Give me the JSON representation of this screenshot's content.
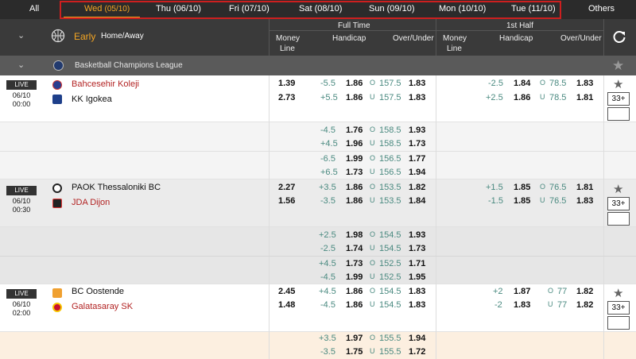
{
  "date_tabs": [
    {
      "label": "All"
    },
    {
      "label": "Wed",
      "date": "(05/10)"
    },
    {
      "label": "Thu (06/10)"
    },
    {
      "label": "Fri (07/10)"
    },
    {
      "label": "Sat (08/10)"
    },
    {
      "label": "Sun (09/10)"
    },
    {
      "label": "Mon (10/10)"
    },
    {
      "label": "Tue (11/10)"
    },
    {
      "label": "Others"
    }
  ],
  "header": {
    "mode": "Early",
    "market": "Home/Away",
    "full_time": "Full Time",
    "first_half": "1st Half",
    "money_line_1": "Money",
    "money_line_2": "Line",
    "handicap": "Handicap",
    "over_under": "Over/Under"
  },
  "league": {
    "name": "Basketball Champions League"
  },
  "matches": [
    {
      "live": "LIVE",
      "date": "06/10",
      "time": "00:00",
      "home": "Bahcesehir Koleji",
      "away": "KK Igokea",
      "ml": [
        "1.39",
        "2.73"
      ],
      "ft_hdp": [
        [
          "-5.5",
          "1.86"
        ],
        [
          "+5.5",
          "1.86"
        ]
      ],
      "ft_ou": [
        [
          "O",
          "157.5",
          "1.83"
        ],
        [
          "U",
          "157.5",
          "1.83"
        ]
      ],
      "h1_hdp": [
        [
          "-2.5",
          "1.84"
        ],
        [
          "+2.5",
          "1.86"
        ]
      ],
      "h1_ou": [
        [
          "O",
          "78.5",
          "1.83"
        ],
        [
          "U",
          "78.5",
          "1.81"
        ]
      ],
      "more": "33+",
      "extra": [
        [
          "-4.5",
          "1.76",
          "O",
          "158.5",
          "1.93"
        ],
        [
          "+4.5",
          "1.96",
          "U",
          "158.5",
          "1.73"
        ],
        [
          "-6.5",
          "1.99",
          "O",
          "156.5",
          "1.77"
        ],
        [
          "+6.5",
          "1.73",
          "U",
          "156.5",
          "1.94"
        ]
      ]
    },
    {
      "live": "LIVE",
      "date": "06/10",
      "time": "00:30",
      "home": "PAOK Thessaloniki BC",
      "away": "JDA Dijon",
      "ml": [
        "2.27",
        "1.56"
      ],
      "ft_hdp": [
        [
          "+3.5",
          "1.86"
        ],
        [
          "-3.5",
          "1.86"
        ]
      ],
      "ft_ou": [
        [
          "O",
          "153.5",
          "1.82"
        ],
        [
          "U",
          "153.5",
          "1.84"
        ]
      ],
      "h1_hdp": [
        [
          "+1.5",
          "1.85"
        ],
        [
          "-1.5",
          "1.85"
        ]
      ],
      "h1_ou": [
        [
          "O",
          "76.5",
          "1.81"
        ],
        [
          "U",
          "76.5",
          "1.83"
        ]
      ],
      "more": "33+",
      "extra": [
        [
          "+2.5",
          "1.98",
          "O",
          "154.5",
          "1.93"
        ],
        [
          "-2.5",
          "1.74",
          "U",
          "154.5",
          "1.73"
        ],
        [
          "+4.5",
          "1.73",
          "O",
          "152.5",
          "1.71"
        ],
        [
          "-4.5",
          "1.99",
          "U",
          "152.5",
          "1.95"
        ]
      ]
    },
    {
      "live": "LIVE",
      "date": "06/10",
      "time": "02:00",
      "home": "BC Oostende",
      "away": "Galatasaray SK",
      "ml": [
        "2.45",
        "1.48"
      ],
      "ft_hdp": [
        [
          "+4.5",
          "1.86"
        ],
        [
          "-4.5",
          "1.86"
        ]
      ],
      "ft_ou": [
        [
          "O",
          "154.5",
          "1.83"
        ],
        [
          "U",
          "154.5",
          "1.83"
        ]
      ],
      "h1_hdp": [
        [
          "+2",
          "1.87"
        ],
        [
          "-2",
          "1.83"
        ]
      ],
      "h1_ou": [
        [
          "O",
          "77",
          "1.82"
        ],
        [
          "U",
          "77",
          "1.82"
        ]
      ],
      "more": "33+",
      "extra": [
        [
          "+3.5",
          "1.97",
          "O",
          "155.5",
          "1.94"
        ],
        [
          "-3.5",
          "1.75",
          "U",
          "155.5",
          "1.72"
        ]
      ]
    }
  ],
  "colors": {
    "accent": "#f5a623",
    "highlight_box": "#cc1f1f",
    "team_red": "#b22222",
    "teal": "#4a8a80"
  }
}
